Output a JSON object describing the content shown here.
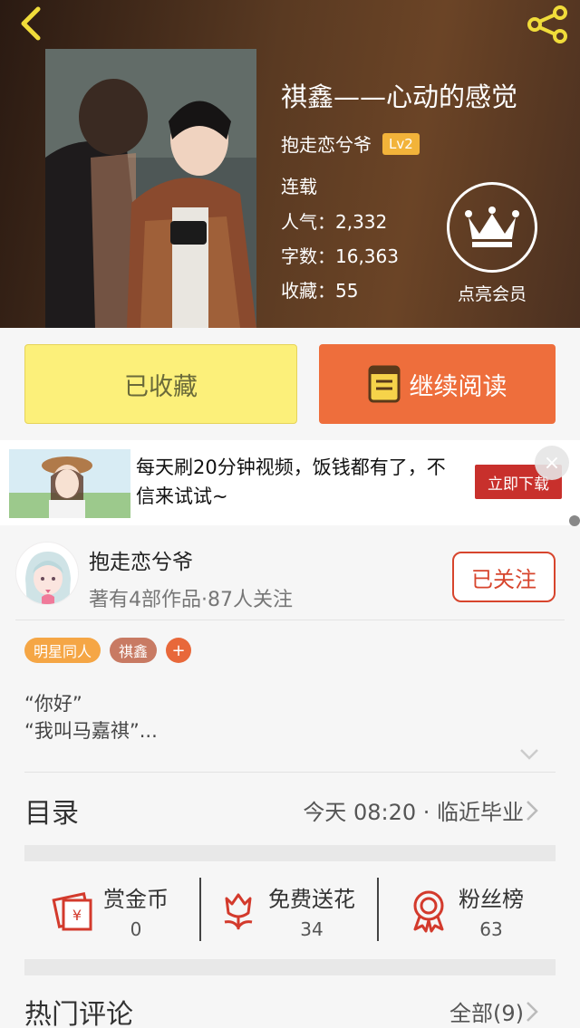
{
  "book": {
    "title": "祺鑫——心动的感觉",
    "author": "抱走恋兮爷",
    "author_level": "Lv2",
    "status": "连载",
    "popularity_label": "人气：",
    "popularity": "2,332",
    "words_label": "字数：",
    "words": "16,363",
    "favorites_label": "收藏：",
    "favorites": "55",
    "vip_label": "点亮会员"
  },
  "actions": {
    "favorited": "已收藏",
    "continue_reading": "继续阅读"
  },
  "ad": {
    "text": "每天刷20分钟视频，饭钱都有了，不信来试试~",
    "button": "立即下载",
    "close": "×"
  },
  "author_card": {
    "name": "抱走恋兮爷",
    "subtitle": "著有4部作品·87人关注",
    "follow_button": "已关注"
  },
  "tags": [
    "明星同人",
    "祺鑫",
    "+"
  ],
  "intro": {
    "line1": "“你好”",
    "line2": "“我叫马嘉祺”..."
  },
  "catalog": {
    "title": "目录",
    "latest": "今天 08:20 · 临近毕业"
  },
  "stats": [
    {
      "label": "赏金币",
      "value": "0",
      "icon": "red-envelope-icon"
    },
    {
      "label": "免费送花",
      "value": "34",
      "icon": "flower-icon"
    },
    {
      "label": "粉丝榜",
      "value": "63",
      "icon": "medal-icon"
    }
  ],
  "comments": {
    "title": "热门评论",
    "all": "全部(9)"
  },
  "colors": {
    "accent_orange": "#ee6e3c",
    "favorite_yellow": "#fcf07a",
    "follow_red": "#d7452d",
    "level_badge": "#f2b33a"
  }
}
